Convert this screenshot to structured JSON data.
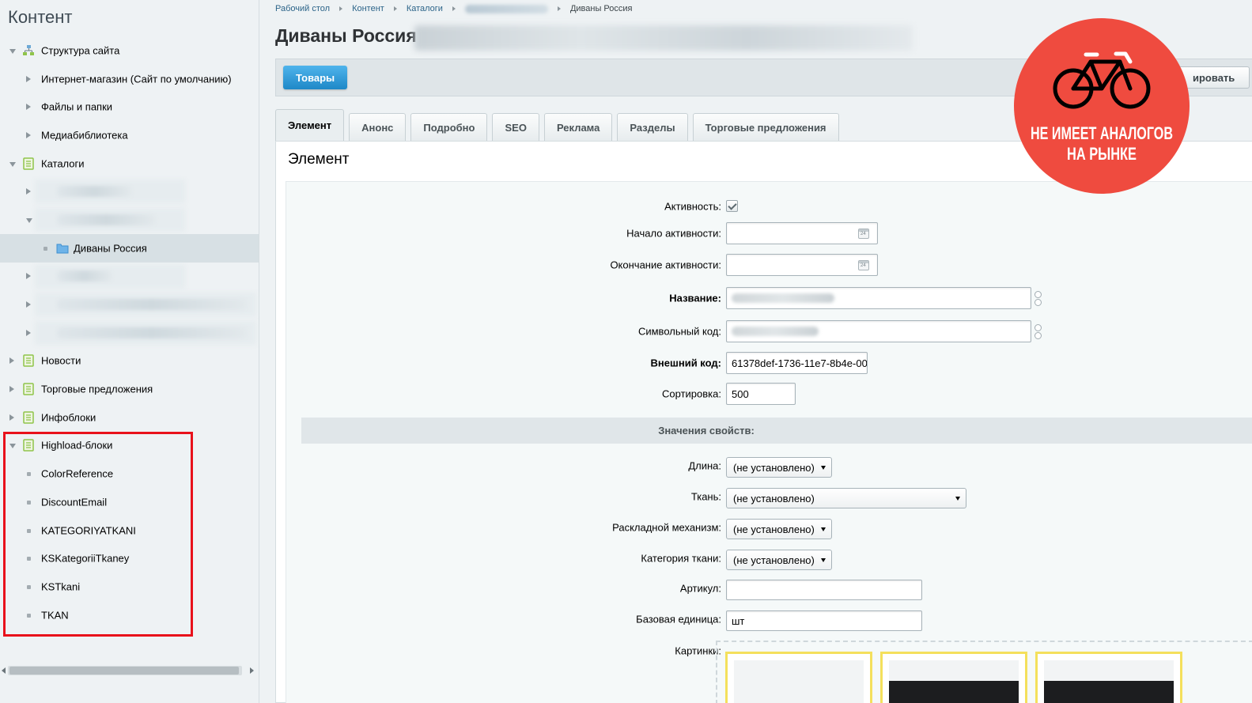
{
  "sidebar": {
    "title": "Контент",
    "tree": [
      {
        "label": "Структура сайта",
        "level": 0,
        "arrow": "down",
        "icon": "site-structure-icon"
      },
      {
        "label": "Интернет-магазин (Сайт по умолчанию)",
        "level": 1,
        "arrow": "right",
        "icon": ""
      },
      {
        "label": "Файлы и папки",
        "level": 1,
        "arrow": "right",
        "icon": ""
      },
      {
        "label": "Медиабиблиотека",
        "level": 1,
        "arrow": "right",
        "icon": ""
      },
      {
        "label": "Каталоги",
        "level": 0,
        "arrow": "down",
        "icon": "catalog-icon"
      },
      {
        "label": "",
        "level": 1,
        "arrow": "right",
        "icon": "iblock-icon",
        "blurred": true
      },
      {
        "label": "",
        "level": 1,
        "arrow": "down",
        "icon": "iblock-icon",
        "blurred": true
      },
      {
        "label": "Диваны Россия",
        "level": 2,
        "arrow": "dot",
        "icon": "folder-icon",
        "selected": true
      },
      {
        "label": "",
        "level": 1,
        "arrow": "right",
        "icon": "iblock-icon",
        "blurred": true
      },
      {
        "label": "",
        "level": 1,
        "arrow": "right",
        "icon": "iblock-icon",
        "blurred": true
      },
      {
        "label": "",
        "level": 1,
        "arrow": "right",
        "icon": "iblock-icon",
        "blurred": true
      },
      {
        "label": "Новости",
        "level": 0,
        "arrow": "right",
        "icon": "news-icon"
      },
      {
        "label": "Торговые предложения",
        "level": 0,
        "arrow": "right",
        "icon": "offers-icon"
      },
      {
        "label": "Инфоблоки",
        "level": 0,
        "arrow": "right",
        "icon": "iblocks-icon"
      },
      {
        "label": "Highload-блоки",
        "level": 0,
        "arrow": "down",
        "icon": "highload-icon"
      },
      {
        "label": "ColorReference",
        "level": 1,
        "arrow": "dot",
        "icon": ""
      },
      {
        "label": "DiscountEmail",
        "level": 1,
        "arrow": "dot",
        "icon": ""
      },
      {
        "label": "KATEGORIYATKANI",
        "level": 1,
        "arrow": "dot",
        "icon": ""
      },
      {
        "label": "KSKategoriiTkaney",
        "level": 1,
        "arrow": "dot",
        "icon": ""
      },
      {
        "label": "KSTkani",
        "level": 1,
        "arrow": "dot",
        "icon": ""
      },
      {
        "label": "TKAN",
        "level": 1,
        "arrow": "dot",
        "icon": ""
      }
    ]
  },
  "breadcrumbs": [
    "Рабочий стол",
    "Контент",
    "Каталоги",
    "",
    "Диваны Россия"
  ],
  "page_title": "Диваны Россия",
  "toolbar": {
    "goods_label": "Товары",
    "copy_label": "ировать"
  },
  "tabs": [
    "Элемент",
    "Анонс",
    "Подробно",
    "SEO",
    "Реклама",
    "Разделы",
    "Торговые предложения"
  ],
  "active_tab": "Элемент",
  "main": {
    "form": {
      "section_title": "Элемент",
      "fields": {
        "active_label": "Активность:",
        "active_checked": true,
        "start_label": "Начало активности:",
        "start_value": "",
        "end_label": "Окончание активности:",
        "end_value": "",
        "name_label": "Название:",
        "name_value": "",
        "code_label": "Символьный код:",
        "code_value": "",
        "xml_label": "Внешний код:",
        "xml_value": "61378def-1736-11e7-8b4e-00",
        "sort_label": "Сортировка:",
        "sort_value": "500"
      },
      "props_header": "Значения свойств:",
      "props": {
        "length_label": "Длина:",
        "length_value": "(не установлено)",
        "fabric_label": "Ткань:",
        "fabric_value": "(не установлено)",
        "mechanism_label": "Раскладной механизм:",
        "mechanism_value": "(не установлено)",
        "fabric_cat_label": "Категория ткани:",
        "fabric_cat_value": "(не установлено)",
        "article_label": "Артикул:",
        "article_value": "",
        "unit_label": "Базовая единица:",
        "unit_value": "шт",
        "pictures_label": "Картинки:"
      }
    }
  },
  "badge": {
    "lines": [
      "НЕ ИМЕЕТ АНАЛОГОВ",
      "НА РЫНКЕ"
    ],
    "color": "#ef4b3f"
  },
  "colors": {
    "accent": "#1e88c7",
    "highlight": "#e8111b",
    "sidebar_bg": "#eef2f4"
  }
}
